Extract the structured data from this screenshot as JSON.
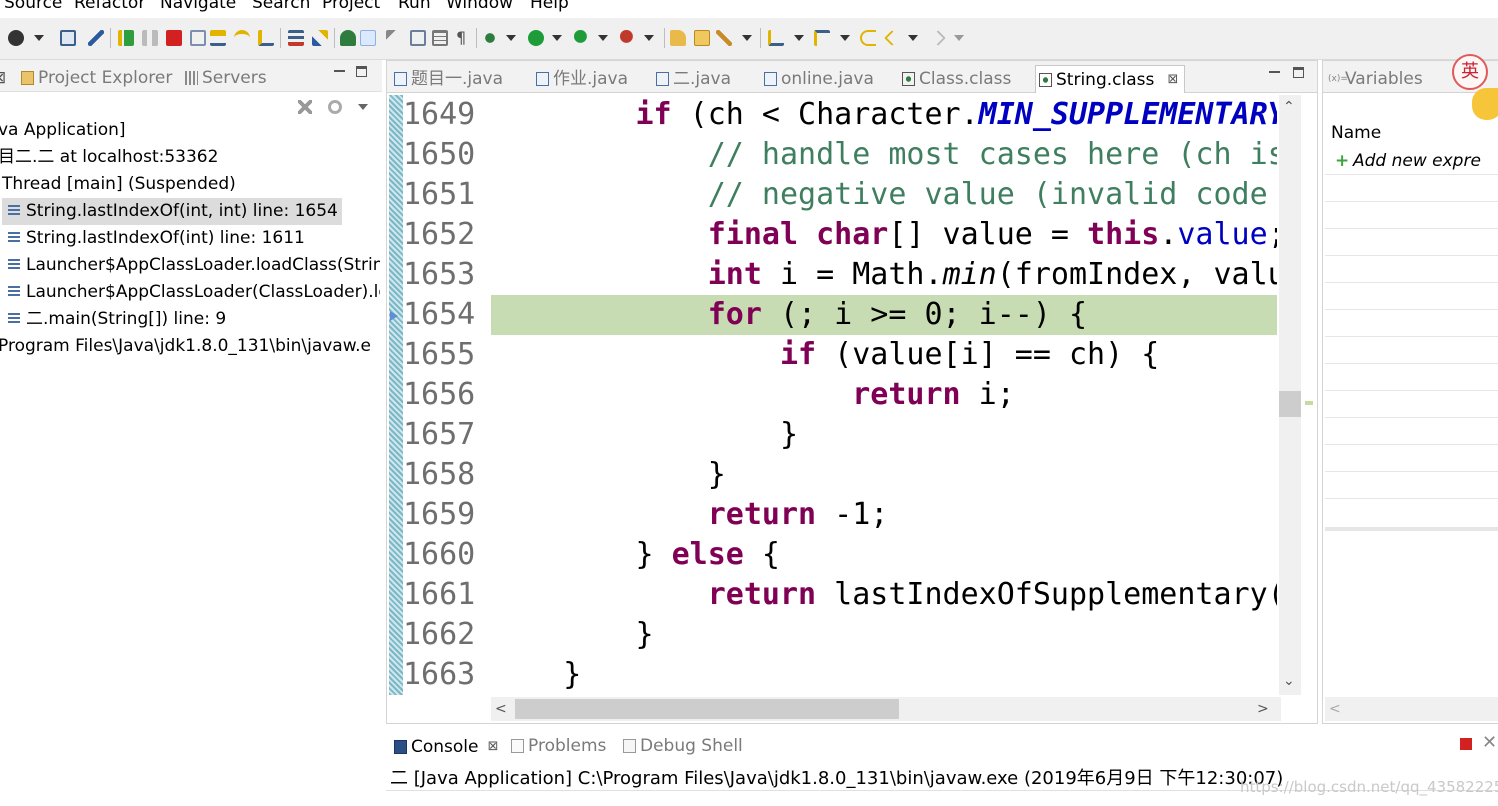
{
  "menu": [
    "Source",
    "Refactor",
    "Navigate",
    "Search",
    "Project",
    "Run",
    "Window",
    "Help"
  ],
  "debug_view": {
    "tabs": [
      {
        "label": "Project Explorer",
        "icon": "project-explorer-icon"
      },
      {
        "label": "Servers",
        "icon": "servers-icon"
      }
    ],
    "tree": [
      {
        "text": "va Application]"
      },
      {
        "text": "目二.二 at localhost:53362"
      },
      {
        "text": "Thread [main] (Suspended)"
      },
      {
        "text": "String.lastIndexOf(int, int) line: 1654",
        "selected": true
      },
      {
        "text": "String.lastIndexOf(int) line: 1611"
      },
      {
        "text": "Launcher$AppClassLoader.loadClass(Strin"
      },
      {
        "text": "Launcher$AppClassLoader(ClassLoader).lo"
      },
      {
        "text": "二.main(String[]) line: 9"
      },
      {
        "text": "Program Files\\Java\\jdk1.8.0_131\\bin\\javaw.e"
      }
    ]
  },
  "editor": {
    "tabs": [
      {
        "label": "题目一.java",
        "icon": "java-file-icon"
      },
      {
        "label": "作业.java",
        "icon": "java-file-icon"
      },
      {
        "label": "二.java",
        "icon": "java-file-icon"
      },
      {
        "label": "online.java",
        "icon": "java-file-icon"
      },
      {
        "label": "Class.class",
        "icon": "class-file-icon"
      },
      {
        "label": "String.class",
        "icon": "class-file-icon",
        "active": true,
        "close": "⊠"
      }
    ],
    "highlight_line": 1654,
    "line_numbers": [
      "1649",
      "1650",
      "1651",
      "1652",
      "1653",
      "1654",
      "1655",
      "1656",
      "1657",
      "1658",
      "1659",
      "1660",
      "1661",
      "1662",
      "1663"
    ]
  },
  "variables": {
    "tab": "Variables",
    "header": "Name",
    "add_expr": "Add new expre",
    "ime": "英"
  },
  "console": {
    "tabs": [
      {
        "label": "Console",
        "icon": "console-icon",
        "active": true,
        "close": "⊠"
      },
      {
        "label": "Problems",
        "icon": "problems-icon"
      },
      {
        "label": "Debug Shell",
        "icon": "debug-shell-icon"
      }
    ],
    "line": "二 [Java Application] C:\\Program Files\\Java\\jdk1.8.0_131\\bin\\javaw.exe (2019年6月9日 下午12:30:07)",
    "watermark": "https://blog.csdn.net/qq_43582225"
  },
  "colors": {
    "keyword": "#7f0055",
    "comment": "#3f7f5f",
    "constant": "#0000c0",
    "current_line": "#c7dcb2"
  }
}
